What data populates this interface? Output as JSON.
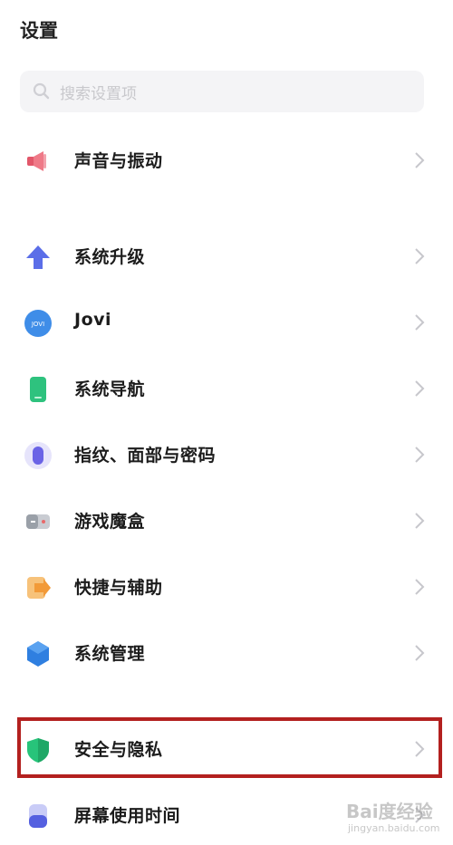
{
  "header": {
    "title": "设置"
  },
  "search": {
    "placeholder": "搜索设置项",
    "icon": "search-icon"
  },
  "items": [
    {
      "label": "声音与振动",
      "icon": "speaker-icon",
      "color": "#e2576a"
    },
    {
      "label": "系统升级",
      "icon": "upgrade-arrow-icon",
      "color": "#5b6ee8"
    },
    {
      "label": "Jovi",
      "icon": "jovi-icon",
      "color": "#3f8de8",
      "icon_text": "JOVI"
    },
    {
      "label": "系统导航",
      "icon": "phone-icon",
      "color": "#2ec27e"
    },
    {
      "label": "指纹、面部与密码",
      "icon": "fingerprint-icon",
      "color": "#6a63e6"
    },
    {
      "label": "游戏魔盒",
      "icon": "gamebox-icon",
      "color": "#9aa0a8"
    },
    {
      "label": "快捷与辅助",
      "icon": "shortcut-icon",
      "color": "#f29a38"
    },
    {
      "label": "系统管理",
      "icon": "hexagon-icon",
      "color": "#2f7fe0"
    },
    {
      "label": "安全与隐私",
      "icon": "shield-icon",
      "color": "#27c47a"
    },
    {
      "label": "屏幕使用时间",
      "icon": "hourglass-icon",
      "color": "#5560e0"
    }
  ],
  "highlight": {
    "target": "安全与隐私",
    "color": "#b3201f"
  },
  "watermark": {
    "text": "Bai度经验",
    "subtext": "jingyan.baidu.com"
  }
}
